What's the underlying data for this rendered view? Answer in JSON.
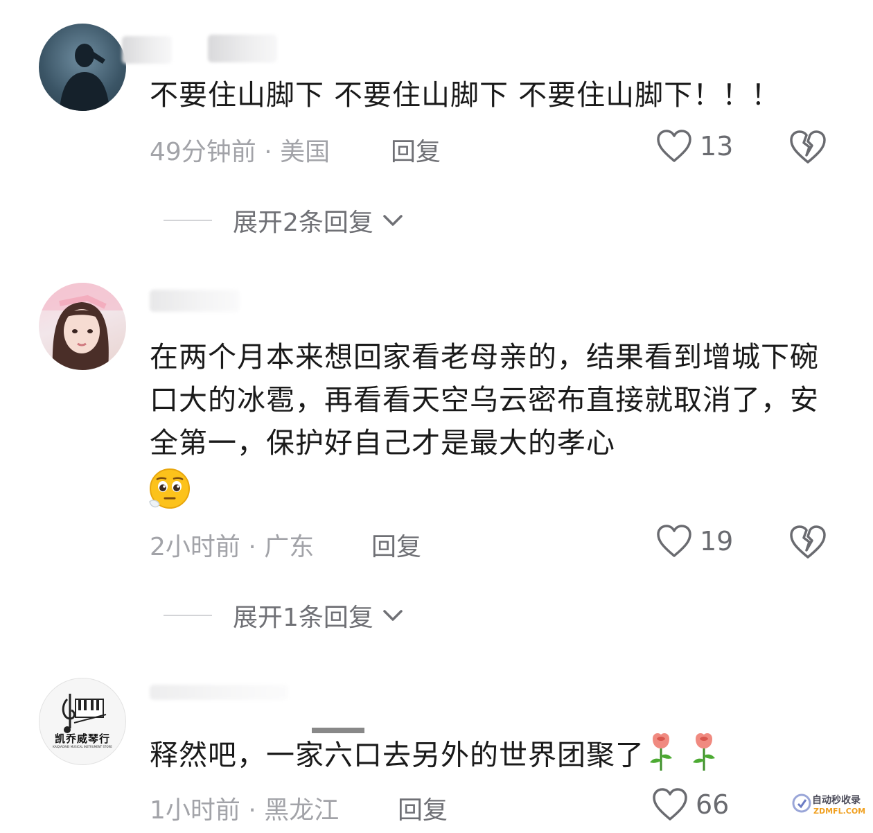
{
  "comments": [
    {
      "text": "不要住山脚下 不要住山脚下 不要住山脚下！！！",
      "time_location": "49分钟前 · 美国",
      "reply_label": "回复",
      "likes": "13",
      "expand_label": "展开2条回复"
    },
    {
      "text": "在两个月本来想回家看老母亲的，结果看到增城下碗口大的冰雹，再看看天空乌云密布直接就取消了，安全第一，保护好自己才是最大的孝心",
      "time_location": "2小时前 · 广东",
      "reply_label": "回复",
      "likes": "19",
      "expand_label": "展开1条回复"
    },
    {
      "text": "释然吧，一家六口去另外的世界团聚了",
      "time_location": "1小时前 · 黑龙江",
      "reply_label": "回复",
      "likes": "66",
      "avatar_text": "凯乔威琴行",
      "avatar_subtext": "KAIQIAOWEI MUSICAL INSTRUMENT STORE"
    }
  ],
  "watermark": {
    "line1": "自动秒收录",
    "line2": "ZDMFL.COM"
  },
  "colors": {
    "text": "#1a1a1a",
    "meta": "#a2a3a8",
    "secondary": "#6f7075"
  },
  "icons": [
    "heart-outline-icon",
    "broken-heart-icon",
    "chevron-down-icon",
    "pleading-face-emoji",
    "rose-emoji"
  ]
}
